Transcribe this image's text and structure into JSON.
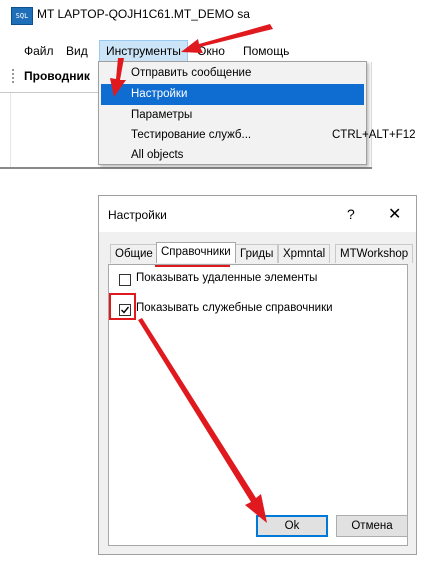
{
  "app": {
    "icon_text": "SQL",
    "title": "MT LAPTOP-QOJH1C61.MT_DEMO sa",
    "menu": [
      "Файл",
      "Вид",
      "Инструменты",
      "Окно",
      "Помощь"
    ],
    "toolbar_label": "Проводник"
  },
  "dropdown": {
    "items": [
      {
        "label": "Отправить сообщение",
        "shortcut": ""
      },
      {
        "label": "Настройки",
        "shortcut": ""
      },
      {
        "label": "Параметры",
        "shortcut": ""
      },
      {
        "label": "Тестирование служб...",
        "shortcut": "CTRL+ALT+F12"
      },
      {
        "label": "All objects",
        "shortcut": ""
      }
    ],
    "selected_index": 1
  },
  "dialog": {
    "title": "Настройки",
    "help": "?",
    "close": "✕",
    "tabs": [
      "Общие",
      "Справочники",
      "Гриды",
      "Xpmntal",
      "MTWorkshop"
    ],
    "active_tab": 1,
    "options": [
      {
        "label": "Показывать удаленные элементы",
        "checked": false
      },
      {
        "label": "Показывать служебные справочники",
        "checked": true
      }
    ],
    "ok_label": "Ok",
    "cancel_label": "Отмена"
  },
  "colors": {
    "annotation": "#e0191e",
    "selection": "#0f6cd1",
    "menu_active": "#cce4f7"
  }
}
